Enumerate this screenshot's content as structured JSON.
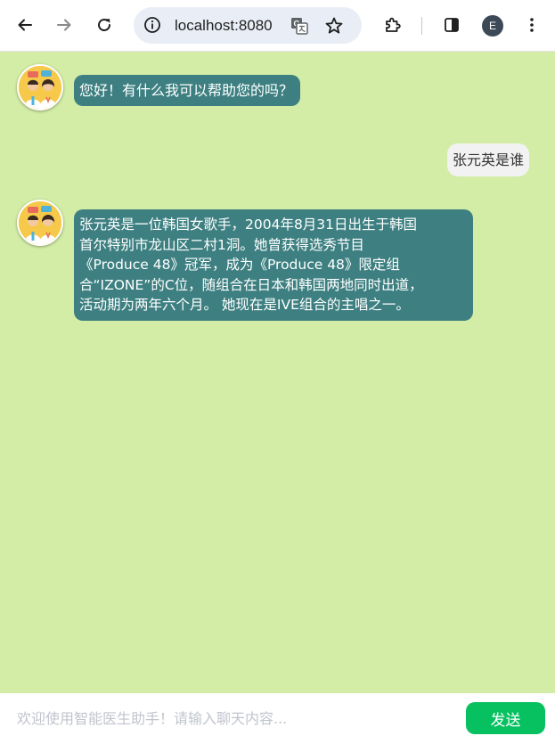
{
  "browser": {
    "url": "localhost:8080",
    "profile_initial": "E"
  },
  "chat": {
    "messages": [
      {
        "role": "bot",
        "text": "您好！有什么我可以帮助您的吗？"
      },
      {
        "role": "user",
        "text": "张元英是谁"
      },
      {
        "role": "bot",
        "lines": [
          "张元英是一位韩国女歌手，2004年8月31日出生于韩国",
          "首尔特别市龙山区二村1洞。她曾获得选秀节目",
          "《Produce 48》冠军，成为《Produce 48》限定组",
          "合“IZONE”的C位，随组合在日本和韩国两地同时出道，",
          "活动期为两年六个月。 她现在是IVE组合的主唱之一。"
        ]
      }
    ]
  },
  "input": {
    "placeholder": "欢迎使用智能医生助手！请输入聊天内容...",
    "value": "",
    "send_label": "发送"
  },
  "colors": {
    "chat_background": "#d3eda6",
    "bot_bubble": "#3e8082",
    "user_bubble": "#f2f2f2",
    "send_button": "#07c160"
  }
}
